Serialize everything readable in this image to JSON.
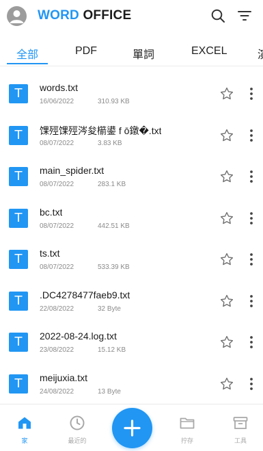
{
  "header": {
    "brand_part1": "WORD",
    "brand_part2": "OFFICE",
    "accent_color": "#2196f3"
  },
  "tabs": [
    {
      "label": "全部",
      "active": true
    },
    {
      "label": "PDF",
      "active": false
    },
    {
      "label": "單詞",
      "active": false
    },
    {
      "label": "EXCEL",
      "active": false
    },
    {
      "label": "演",
      "active": false
    }
  ],
  "files": [
    {
      "name": "words.txt",
      "date": "16/06/2022",
      "size": "310.93 KB",
      "icon": "T"
    },
    {
      "name": "馃殌馃殌涔夋櫤鍙 f ō鐓�.txt",
      "date": "08/07/2022",
      "size": "3.83 KB",
      "icon": "T"
    },
    {
      "name": "main_spider.txt",
      "date": "08/07/2022",
      "size": "283.1 KB",
      "icon": "T"
    },
    {
      "name": "bc.txt",
      "date": "08/07/2022",
      "size": "442.51 KB",
      "icon": "T"
    },
    {
      "name": "ts.txt",
      "date": "08/07/2022",
      "size": "533.39 KB",
      "icon": "T"
    },
    {
      "name": ".DC4278477faeb9.txt",
      "date": "22/08/2022",
      "size": "32 Byte",
      "icon": "T"
    },
    {
      "name": "2022-08-24.log.txt",
      "date": "23/08/2022",
      "size": "15.12 KB",
      "icon": "T"
    },
    {
      "name": "meijuxia.txt",
      "date": "24/08/2022",
      "size": "13 Byte",
      "icon": "T"
    }
  ],
  "bottom_nav": {
    "home_label": "家",
    "recent_label": "最近的",
    "saved_label": "拧存",
    "tools_label": "工具"
  }
}
